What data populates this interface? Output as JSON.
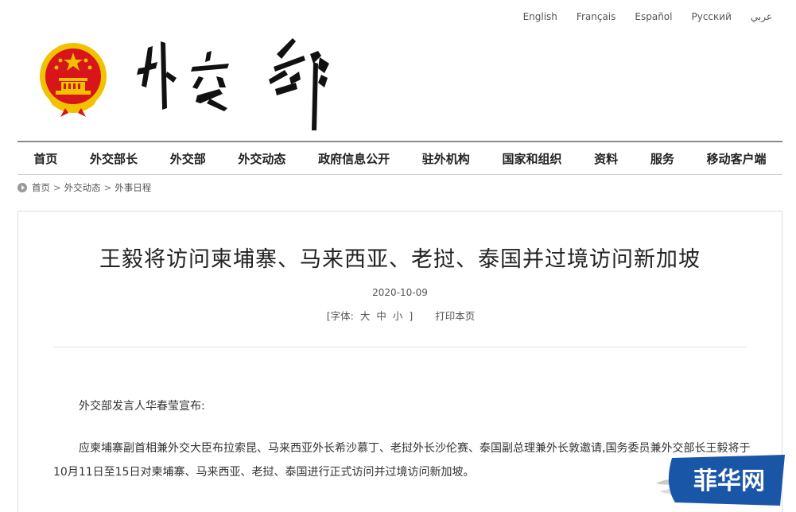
{
  "languages": [
    "English",
    "Français",
    "Español",
    "Русский",
    "عربي"
  ],
  "site": {
    "emblem_icon": "national-emblem-icon",
    "calligraphy_logo_text": "外交部"
  },
  "nav": {
    "items": [
      "首页",
      "外交部长",
      "外交部",
      "外交动态",
      "政府信息公开",
      "驻外机构",
      "国家和组织",
      "资料",
      "服务",
      "移动客户端"
    ]
  },
  "breadcrumb": {
    "items": [
      "首页",
      "外交动态",
      "外事日程"
    ],
    "separator": ">"
  },
  "article": {
    "title": "王毅将访问柬埔寨、马来西亚、老挝、泰国并过境访问新加坡",
    "date": "2020-10-09",
    "font_label": "[字体:",
    "font_large": "大",
    "font_medium": "中",
    "font_small": "小",
    "font_close": "]",
    "print_label": "打印本页",
    "paragraph1": "外交部发言人华春莹宣布:",
    "paragraph2": "应柬埔寨副首相兼外交大臣布拉索昆、马来西亚外长希沙慕丁、老挝外长沙伦赛、泰国副总理兼外长敦邀请,国务委员兼外交部长王毅将于10月11日至15日对柬埔寨、马来西亚、老挝、泰国进行正式访问并过境访问新加坡。"
  },
  "watermark": {
    "text": "菲华网"
  },
  "colors": {
    "emblem_red": "#d7151a",
    "emblem_gold": "#f2c200",
    "nav_border": "#8a8a8a",
    "watermark_blue": "#1a56a8"
  }
}
